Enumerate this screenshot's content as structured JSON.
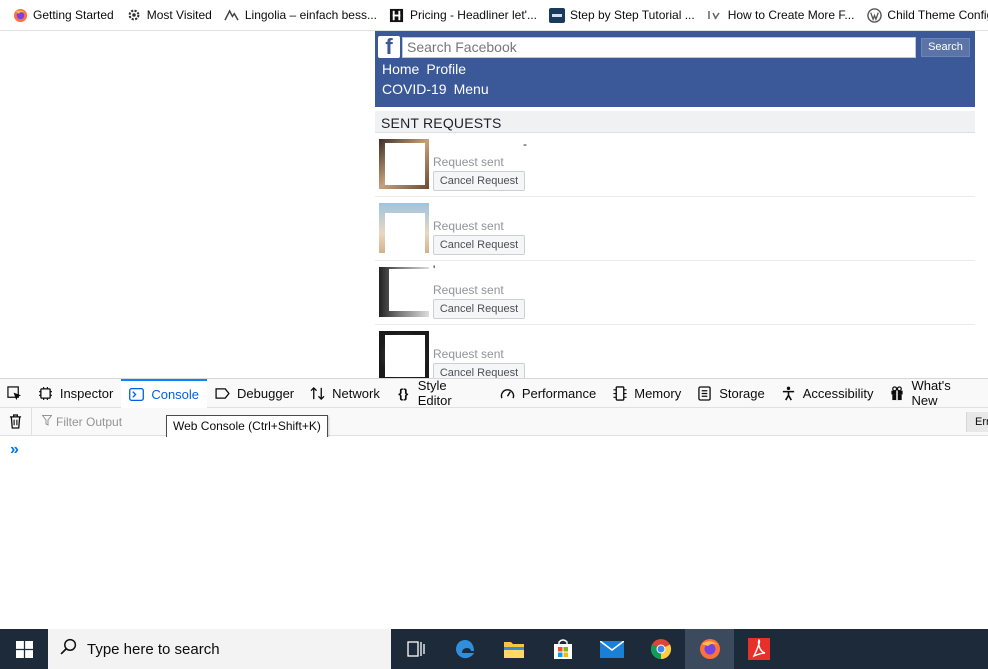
{
  "bookmarks": [
    {
      "label": "Getting Started",
      "icon": "firefox-icon"
    },
    {
      "label": "Most Visited",
      "icon": "gear-icon"
    },
    {
      "label": "Lingolia – einfach bess...",
      "icon": "lingolia-icon"
    },
    {
      "label": "Pricing - Headliner let'...",
      "icon": "headliner-icon"
    },
    {
      "label": "Step by Step Tutorial ...",
      "icon": "tds-icon"
    },
    {
      "label": "How to Create More F...",
      "icon": "ly-icon"
    },
    {
      "label": "Child Theme Configur",
      "icon": "wordpress-icon"
    }
  ],
  "facebook": {
    "search_placeholder": "Search Facebook",
    "search_button": "Search",
    "nav_row1": [
      "Home",
      "Profile"
    ],
    "nav_row2": [
      "COVID-19",
      "Menu"
    ],
    "section_title": "SENT REQUESTS",
    "requests": [
      {
        "name": "-",
        "status": "Request sent",
        "cancel_label": "Cancel Request"
      },
      {
        "name": "",
        "status": "Request sent",
        "cancel_label": "Cancel Request"
      },
      {
        "name": "'",
        "status": "Request sent",
        "cancel_label": "Cancel Request"
      },
      {
        "name": "",
        "status": "Request sent",
        "cancel_label": "Cancel Request"
      }
    ]
  },
  "devtools": {
    "tabs": [
      {
        "label": "Inspector",
        "icon": "inspector-icon"
      },
      {
        "label": "Console",
        "icon": "console-icon",
        "active": true
      },
      {
        "label": "Debugger",
        "icon": "debugger-icon"
      },
      {
        "label": "Network",
        "icon": "network-icon"
      },
      {
        "label": "Style Editor",
        "icon": "braces-icon"
      },
      {
        "label": "Performance",
        "icon": "performance-icon"
      },
      {
        "label": "Memory",
        "icon": "memory-icon"
      },
      {
        "label": "Storage",
        "icon": "storage-icon"
      },
      {
        "label": "Accessibility",
        "icon": "accessibility-icon"
      },
      {
        "label": "What's New",
        "icon": "gift-icon"
      }
    ],
    "filter_placeholder": "Filter Output",
    "tooltip": "Web Console (Ctrl+Shift+K)",
    "errors_button": "Err",
    "prompt": "»"
  },
  "taskbar": {
    "search_placeholder": "Type here to search",
    "apps": [
      "task-view-icon",
      "edge-icon",
      "file-explorer-icon",
      "store-icon",
      "mail-icon",
      "chrome-icon",
      "firefox-icon",
      "acrobat-icon"
    ]
  },
  "colors": {
    "facebook_blue": "#3b5998",
    "devtools_active": "#0a84ff",
    "taskbar": "#1c2a3a"
  }
}
